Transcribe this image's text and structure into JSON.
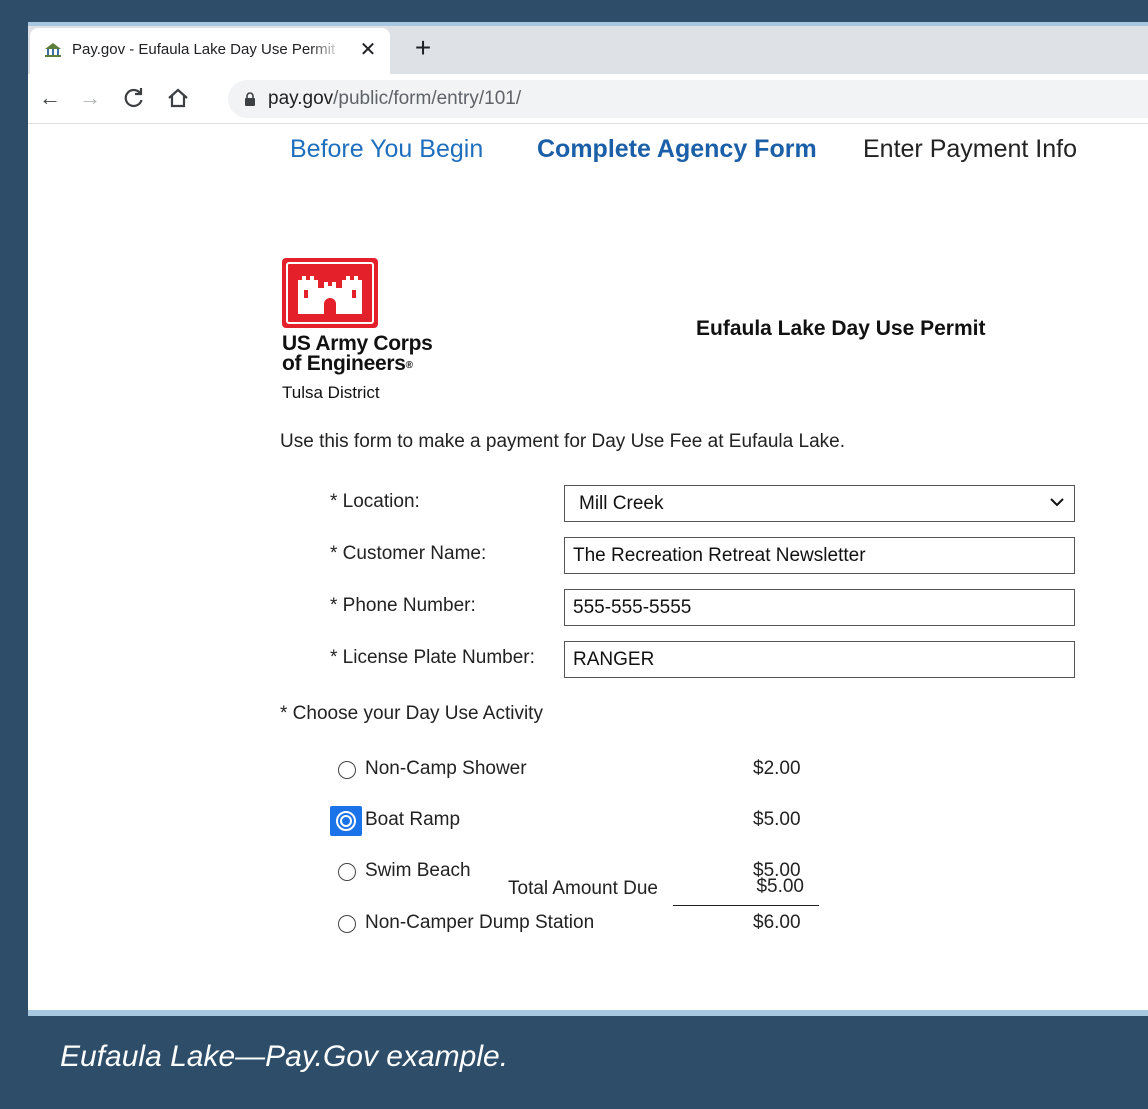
{
  "browser": {
    "tab_title": "Pay.gov - Eufaula Lake Day Use Permit",
    "tab_close": "✕",
    "new_tab": "+",
    "url_host": "pay.gov",
    "url_path": "/public/form/entry/101/",
    "favicon": "pay-gov-building-icon"
  },
  "steps": {
    "before": "Before You Begin",
    "complete": "Complete Agency Form",
    "payment": "Enter Payment Info"
  },
  "agency": {
    "line1": "US Army Corps",
    "line2": "of Engineers",
    "reg_mark": "®",
    "district": "Tulsa District",
    "logo_color": "#e4202b"
  },
  "form": {
    "title": "Eufaula Lake Day Use Permit",
    "intro": "Use this form to make a payment for Day Use Fee at Eufaula Lake.",
    "location_label": "* Location:",
    "location_value": "Mill Creek",
    "customer_label": "* Customer Name:",
    "customer_value": "The Recreation Retreat Newsletter",
    "phone_label": "* Phone Number:",
    "phone_value": "555-555-5555",
    "plate_label": "* License Plate Number:",
    "plate_value": "RANGER",
    "activity_heading": "* Choose your Day Use Activity",
    "activities": [
      {
        "label": "Non-Camp Shower",
        "price": "$2.00",
        "selected": false
      },
      {
        "label": "Boat Ramp",
        "price": "$5.00",
        "selected": true
      },
      {
        "label": "Swim Beach",
        "price": "$5.00",
        "selected": false
      },
      {
        "label": "Non-Camper Dump Station",
        "price": "$6.00",
        "selected": false
      }
    ],
    "total_label": "Total Amount Due",
    "total_value": "$5.00"
  },
  "caption": "Eufaula Lake—Pay.Gov example.",
  "colors": {
    "background": "#2d4d69",
    "link": "#1f6fbf",
    "active_step": "#1a5fa8",
    "radio_focus": "#1a73e8"
  }
}
